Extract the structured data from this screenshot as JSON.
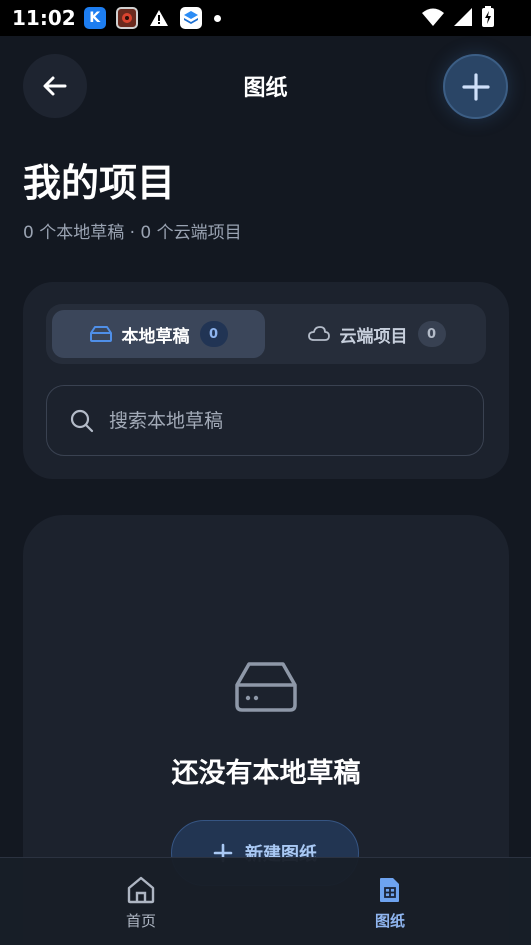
{
  "status_bar": {
    "time": "11:02"
  },
  "header": {
    "title": "图纸"
  },
  "page": {
    "title": "我的项目",
    "subtitle": "0 个本地草稿 · 0 个云端项目"
  },
  "tabs": [
    {
      "label": "本地草稿",
      "count": "0",
      "icon": "drive-icon",
      "active": true
    },
    {
      "label": "云端项目",
      "count": "0",
      "icon": "cloud-icon",
      "active": false
    }
  ],
  "search": {
    "placeholder": "搜索本地草稿",
    "value": ""
  },
  "empty_state": {
    "title": "还没有本地草稿",
    "button_label": "新建图纸"
  },
  "bottom_nav": [
    {
      "label": "首页",
      "icon": "home-icon",
      "active": false
    },
    {
      "label": "图纸",
      "icon": "drawing-icon",
      "active": true
    }
  ],
  "colors": {
    "background": "#131821",
    "card": "#1c222d",
    "accent": "#8fb5ef",
    "accent_button": "#2a4566"
  }
}
